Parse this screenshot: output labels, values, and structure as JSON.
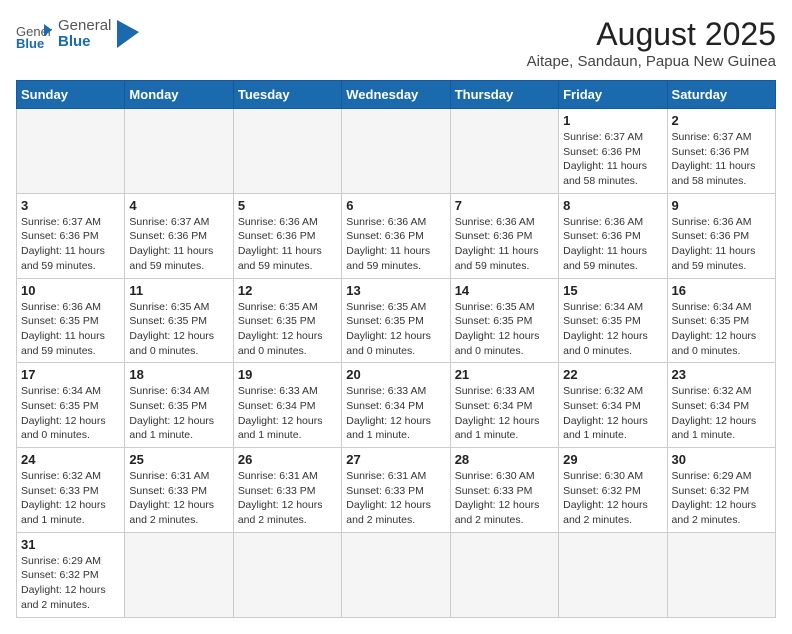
{
  "header": {
    "logo_general": "General",
    "logo_blue": "Blue",
    "title": "August 2025",
    "subtitle": "Aitape, Sandaun, Papua New Guinea"
  },
  "weekdays": [
    "Sunday",
    "Monday",
    "Tuesday",
    "Wednesday",
    "Thursday",
    "Friday",
    "Saturday"
  ],
  "weeks": [
    [
      {
        "day": "",
        "info": ""
      },
      {
        "day": "",
        "info": ""
      },
      {
        "day": "",
        "info": ""
      },
      {
        "day": "",
        "info": ""
      },
      {
        "day": "",
        "info": ""
      },
      {
        "day": "1",
        "info": "Sunrise: 6:37 AM\nSunset: 6:36 PM\nDaylight: 11 hours\nand 58 minutes."
      },
      {
        "day": "2",
        "info": "Sunrise: 6:37 AM\nSunset: 6:36 PM\nDaylight: 11 hours\nand 58 minutes."
      }
    ],
    [
      {
        "day": "3",
        "info": "Sunrise: 6:37 AM\nSunset: 6:36 PM\nDaylight: 11 hours\nand 59 minutes."
      },
      {
        "day": "4",
        "info": "Sunrise: 6:37 AM\nSunset: 6:36 PM\nDaylight: 11 hours\nand 59 minutes."
      },
      {
        "day": "5",
        "info": "Sunrise: 6:36 AM\nSunset: 6:36 PM\nDaylight: 11 hours\nand 59 minutes."
      },
      {
        "day": "6",
        "info": "Sunrise: 6:36 AM\nSunset: 6:36 PM\nDaylight: 11 hours\nand 59 minutes."
      },
      {
        "day": "7",
        "info": "Sunrise: 6:36 AM\nSunset: 6:36 PM\nDaylight: 11 hours\nand 59 minutes."
      },
      {
        "day": "8",
        "info": "Sunrise: 6:36 AM\nSunset: 6:36 PM\nDaylight: 11 hours\nand 59 minutes."
      },
      {
        "day": "9",
        "info": "Sunrise: 6:36 AM\nSunset: 6:36 PM\nDaylight: 11 hours\nand 59 minutes."
      }
    ],
    [
      {
        "day": "10",
        "info": "Sunrise: 6:36 AM\nSunset: 6:35 PM\nDaylight: 11 hours\nand 59 minutes."
      },
      {
        "day": "11",
        "info": "Sunrise: 6:35 AM\nSunset: 6:35 PM\nDaylight: 12 hours\nand 0 minutes."
      },
      {
        "day": "12",
        "info": "Sunrise: 6:35 AM\nSunset: 6:35 PM\nDaylight: 12 hours\nand 0 minutes."
      },
      {
        "day": "13",
        "info": "Sunrise: 6:35 AM\nSunset: 6:35 PM\nDaylight: 12 hours\nand 0 minutes."
      },
      {
        "day": "14",
        "info": "Sunrise: 6:35 AM\nSunset: 6:35 PM\nDaylight: 12 hours\nand 0 minutes."
      },
      {
        "day": "15",
        "info": "Sunrise: 6:34 AM\nSunset: 6:35 PM\nDaylight: 12 hours\nand 0 minutes."
      },
      {
        "day": "16",
        "info": "Sunrise: 6:34 AM\nSunset: 6:35 PM\nDaylight: 12 hours\nand 0 minutes."
      }
    ],
    [
      {
        "day": "17",
        "info": "Sunrise: 6:34 AM\nSunset: 6:35 PM\nDaylight: 12 hours\nand 0 minutes."
      },
      {
        "day": "18",
        "info": "Sunrise: 6:34 AM\nSunset: 6:35 PM\nDaylight: 12 hours\nand 1 minute."
      },
      {
        "day": "19",
        "info": "Sunrise: 6:33 AM\nSunset: 6:34 PM\nDaylight: 12 hours\nand 1 minute."
      },
      {
        "day": "20",
        "info": "Sunrise: 6:33 AM\nSunset: 6:34 PM\nDaylight: 12 hours\nand 1 minute."
      },
      {
        "day": "21",
        "info": "Sunrise: 6:33 AM\nSunset: 6:34 PM\nDaylight: 12 hours\nand 1 minute."
      },
      {
        "day": "22",
        "info": "Sunrise: 6:32 AM\nSunset: 6:34 PM\nDaylight: 12 hours\nand 1 minute."
      },
      {
        "day": "23",
        "info": "Sunrise: 6:32 AM\nSunset: 6:34 PM\nDaylight: 12 hours\nand 1 minute."
      }
    ],
    [
      {
        "day": "24",
        "info": "Sunrise: 6:32 AM\nSunset: 6:33 PM\nDaylight: 12 hours\nand 1 minute."
      },
      {
        "day": "25",
        "info": "Sunrise: 6:31 AM\nSunset: 6:33 PM\nDaylight: 12 hours\nand 2 minutes."
      },
      {
        "day": "26",
        "info": "Sunrise: 6:31 AM\nSunset: 6:33 PM\nDaylight: 12 hours\nand 2 minutes."
      },
      {
        "day": "27",
        "info": "Sunrise: 6:31 AM\nSunset: 6:33 PM\nDaylight: 12 hours\nand 2 minutes."
      },
      {
        "day": "28",
        "info": "Sunrise: 6:30 AM\nSunset: 6:33 PM\nDaylight: 12 hours\nand 2 minutes."
      },
      {
        "day": "29",
        "info": "Sunrise: 6:30 AM\nSunset: 6:32 PM\nDaylight: 12 hours\nand 2 minutes."
      },
      {
        "day": "30",
        "info": "Sunrise: 6:29 AM\nSunset: 6:32 PM\nDaylight: 12 hours\nand 2 minutes."
      }
    ],
    [
      {
        "day": "31",
        "info": "Sunrise: 6:29 AM\nSunset: 6:32 PM\nDaylight: 12 hours\nand 2 minutes."
      },
      {
        "day": "",
        "info": ""
      },
      {
        "day": "",
        "info": ""
      },
      {
        "day": "",
        "info": ""
      },
      {
        "day": "",
        "info": ""
      },
      {
        "day": "",
        "info": ""
      },
      {
        "day": "",
        "info": ""
      }
    ]
  ]
}
